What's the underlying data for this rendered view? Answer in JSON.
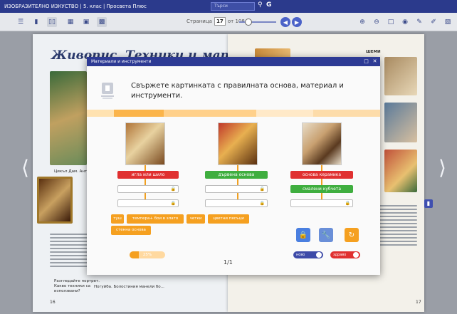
{
  "window": {
    "title": "ИЗОБРАЗИТЕЛНО ИЗКУСТВО | 5. клас | Просвета Плюс",
    "search_placeholder": "Търси"
  },
  "toolbar": {
    "page_label": "Страница",
    "page_number": "17",
    "page_of": "от 108"
  },
  "book": {
    "left_title": "Живопис. Техники и материали",
    "left_page_number": "16",
    "right_page_number": "17",
    "right_heading": "ШЕМИ",
    "left_caption": "Цикъл Дам. Античен...",
    "left_bottom_caption": "Ногуйба. Болостиния манели бо...",
    "left_bullet": "Разгледайте портрет. Какво техники са използвани?"
  },
  "modal": {
    "header_title": "Материали и инструменти",
    "question": "Свържете картинката с правилната основа, материал и инструменти.",
    "columns": [
      {
        "image_name": "fresco-image",
        "label": "игла или шило",
        "label_color": "red",
        "extra_label": ""
      },
      {
        "image_name": "icon-painting-image",
        "label": "дървена основа",
        "label_color": "green",
        "extra_label": ""
      },
      {
        "image_name": "mosaic-bird-image",
        "label": "основа керамика",
        "label_color": "red",
        "extra_label": "смалени кубчета"
      }
    ],
    "chips": [
      "туш",
      "темпера+ бои в злато",
      "четки",
      "цветни пясъци",
      "стенна основа"
    ],
    "progress_value": 0.25,
    "progress_text": "25%",
    "page_count": "1/1",
    "toggle_left_label": "ново",
    "toggle_right_label": "здраво",
    "colors": {
      "accent": "#2d3a94",
      "orange": "#f5a020",
      "red": "#e03030",
      "green": "#3fae3f",
      "action_blue": "#4a7fe0",
      "action_blue2": "#6a8fd8"
    }
  }
}
